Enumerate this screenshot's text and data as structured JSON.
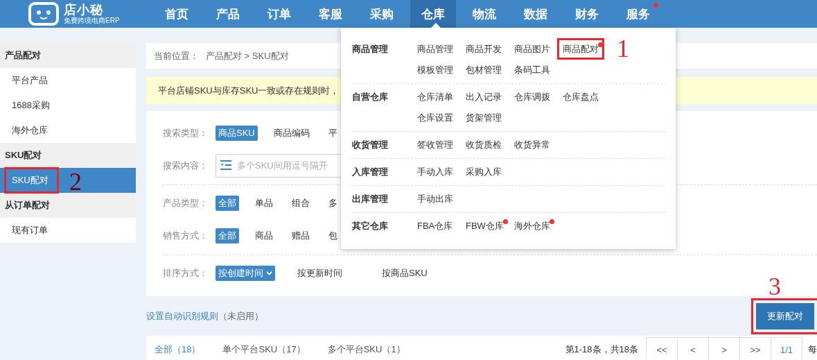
{
  "header": {
    "logo": {
      "name": "店小秘",
      "tagline": "免费跨境电商ERP"
    },
    "nav": [
      {
        "label": "首页",
        "selected": false,
        "dot": false
      },
      {
        "label": "产品",
        "selected": false,
        "dot": false
      },
      {
        "label": "订单",
        "selected": false,
        "dot": false
      },
      {
        "label": "客服",
        "selected": false,
        "dot": false
      },
      {
        "label": "采购",
        "selected": false,
        "dot": false
      },
      {
        "label": "仓库",
        "selected": true,
        "dot": false
      },
      {
        "label": "物流",
        "selected": false,
        "dot": false
      },
      {
        "label": "数据",
        "selected": false,
        "dot": false
      },
      {
        "label": "财务",
        "selected": false,
        "dot": false
      },
      {
        "label": "服务",
        "selected": false,
        "dot": true
      }
    ]
  },
  "sidebar": {
    "groups": [
      {
        "title": "产品配对",
        "items": [
          {
            "label": "平台产品",
            "selected": false
          },
          {
            "label": "1688采购",
            "selected": false
          },
          {
            "label": "海外仓库",
            "selected": false
          }
        ]
      },
      {
        "title": "SKU配对",
        "items": [
          {
            "label": "SKU配对",
            "selected": true,
            "highlighted": true,
            "annotation": "2"
          }
        ]
      },
      {
        "title": "从订单配对",
        "items": [
          {
            "label": "现有订单",
            "selected": false
          }
        ]
      }
    ]
  },
  "breadcrumb": {
    "label": "当前位置：",
    "path": "产品配对 > SKU配对"
  },
  "notice": "平台店铺SKU与库存SKU一致或存在规则时，",
  "filters": [
    {
      "kind": "options",
      "label": "搜索类型：",
      "divider": false,
      "options": [
        {
          "label": "商品SKU",
          "selected": true
        },
        {
          "label": "商品编码",
          "selected": false
        },
        {
          "label": "平",
          "selected": false
        }
      ]
    },
    {
      "kind": "input",
      "label": "搜索内容：",
      "divider": true,
      "placeholder": "多个SKU间用逗号隔开"
    },
    {
      "kind": "options",
      "label": "产品类型：",
      "divider": false,
      "options": [
        {
          "label": "全部",
          "selected": true
        },
        {
          "label": "单品",
          "selected": false
        },
        {
          "label": "组合",
          "selected": false
        },
        {
          "label": "多",
          "selected": false
        }
      ]
    },
    {
      "kind": "options",
      "label": "销售方式：",
      "divider": true,
      "options": [
        {
          "label": "全部",
          "selected": true
        },
        {
          "label": "商品",
          "selected": false
        },
        {
          "label": "赠品",
          "selected": false
        },
        {
          "label": "包",
          "selected": false
        }
      ]
    },
    {
      "kind": "sort",
      "label": "排序方式：",
      "divider": false,
      "options": [
        {
          "label": "按创建时间",
          "selected": true
        },
        {
          "label": "按更新时间",
          "selected": false
        },
        {
          "label": "按商品SKU",
          "selected": false
        }
      ]
    }
  ],
  "rule": {
    "link": "设置自动识别规则",
    "status": "（未启用）"
  },
  "update_button": {
    "label": "更新配对",
    "highlighted": true,
    "annotation": "3"
  },
  "result_tabs": [
    {
      "label": "全部（18）",
      "selected": true
    },
    {
      "label": "单个平台SKU（17）",
      "selected": false
    },
    {
      "label": "多个平台SKU（1）",
      "selected": false
    }
  ],
  "pagination": {
    "summary": "第1-18条，共18条",
    "buttons": [
      "<<",
      "<",
      ">",
      ">>"
    ],
    "page": "1/1",
    "per_page": "每"
  },
  "menu": {
    "groups": [
      {
        "title": "商品管理",
        "items": [
          {
            "label": "商品管理",
            "dot": false
          },
          {
            "label": "商品开发",
            "dot": false
          },
          {
            "label": "商品图片",
            "dot": false
          },
          {
            "label": "商品配对",
            "dot": true,
            "highlighted": true,
            "annotation": "1"
          },
          {
            "label": "模板管理",
            "dot": false
          },
          {
            "label": "包材管理",
            "dot": false
          },
          {
            "label": "条码工具",
            "dot": false
          }
        ]
      },
      {
        "title": "自营仓库",
        "items": [
          {
            "label": "仓库清单",
            "dot": false
          },
          {
            "label": "出入记录",
            "dot": false
          },
          {
            "label": "仓库调拨",
            "dot": false
          },
          {
            "label": "仓库盘点",
            "dot": false
          },
          {
            "label": "仓库设置",
            "dot": false
          },
          {
            "label": "货架管理",
            "dot": false
          }
        ]
      },
      {
        "title": "收货管理",
        "items": [
          {
            "label": "签收管理",
            "dot": false
          },
          {
            "label": "收货质检",
            "dot": false
          },
          {
            "label": "收货异常",
            "dot": false
          }
        ]
      },
      {
        "title": "入库管理",
        "items": [
          {
            "label": "手动入库",
            "dot": false
          },
          {
            "label": "采购入库",
            "dot": false
          }
        ]
      },
      {
        "title": "出库管理",
        "items": [
          {
            "label": "手动出库",
            "dot": false
          }
        ]
      },
      {
        "title": "其它仓库",
        "items": [
          {
            "label": "FBA仓库",
            "dot": false
          },
          {
            "label": "FBW仓库",
            "dot": true
          },
          {
            "label": "海外仓库",
            "dot": true
          }
        ]
      }
    ]
  }
}
